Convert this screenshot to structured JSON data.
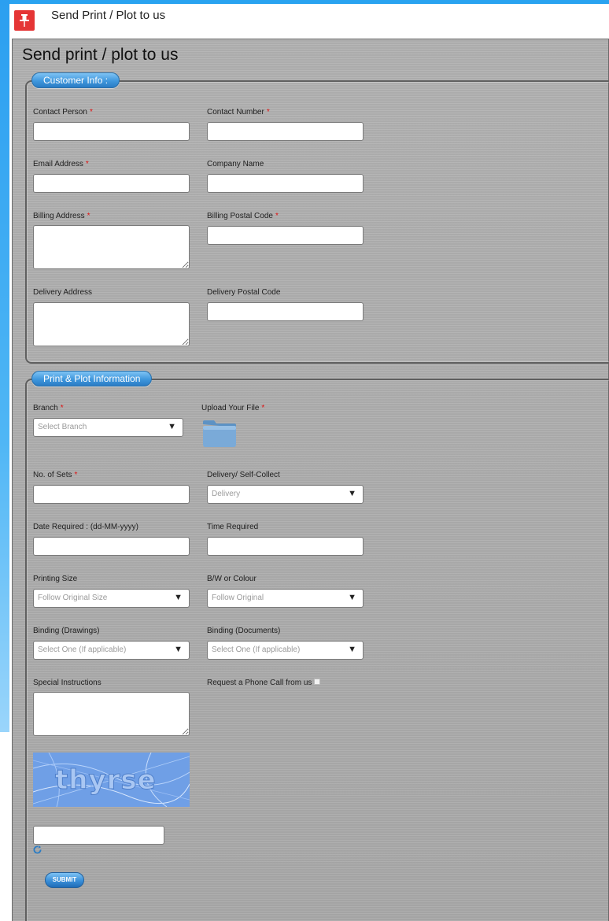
{
  "window": {
    "title": "Send Print / Plot to us",
    "pin_icon": "pin-icon",
    "pin_color": "#e53535"
  },
  "page": {
    "heading": "Send print / plot to us"
  },
  "customer": {
    "legend": "Customer Info :",
    "contact_person": "Contact Person",
    "contact_number": "Contact Number",
    "email": "Email Address",
    "company": "Company Name",
    "billing_address": "Billing Address",
    "billing_postal": "Billing Postal Code",
    "delivery_address": "Delivery Address",
    "delivery_postal": "Delivery Postal Code"
  },
  "print": {
    "legend": "Print & Plot Information",
    "branch": "Branch",
    "branch_value": "Select Branch",
    "upload": "Upload Your File",
    "sets": "No. of Sets",
    "delivery_mode": "Delivery/ Self-Collect",
    "delivery_mode_value": "Delivery",
    "date_required": "Date Required : (dd-MM-yyyy)",
    "time_required": "Time Required",
    "printing_size": "Printing Size",
    "printing_size_value": "Follow Original Size",
    "colour": "B/W or Colour",
    "colour_value": "Follow Original",
    "binding_drawings": "Binding (Drawings)",
    "binding_drawings_value": "Select One (If applicable)",
    "binding_documents": "Binding (Documents)",
    "binding_documents_value": "Select One (If applicable)",
    "special_instructions": "Special Instructions",
    "phone_call": "Request a Phone Call from us",
    "captcha_text": "thyrse",
    "submit": "SUBMIT"
  },
  "colors": {
    "accent": "#3f97dd",
    "required": "#e01010"
  },
  "required_mark": "*"
}
